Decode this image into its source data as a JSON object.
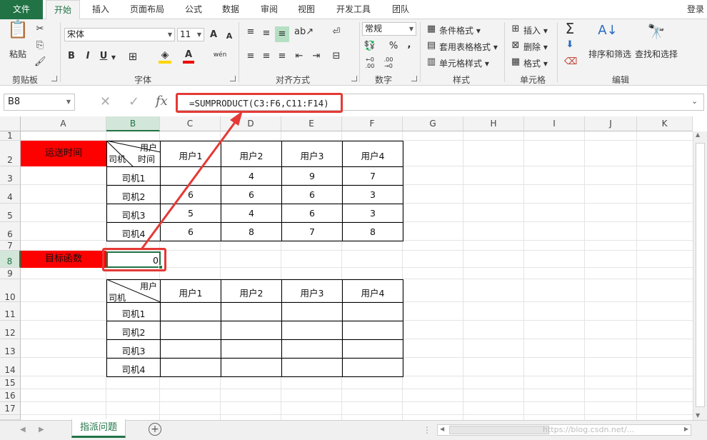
{
  "tabs": [
    "文件",
    "开始",
    "插入",
    "页面布局",
    "公式",
    "数据",
    "审阅",
    "视图",
    "开发工具",
    "团队"
  ],
  "login": "登录",
  "ribbon": {
    "clipboard": {
      "paste": "粘贴",
      "label": "剪贴板"
    },
    "font": {
      "name": "宋体",
      "size": "11",
      "bold": "B",
      "italic": "I",
      "underline": "U",
      "label": "字体",
      "phonetic": "wén"
    },
    "alignment": {
      "label": "对齐方式"
    },
    "number": {
      "format": "常规",
      "percent": "%",
      "comma": ",",
      "label": "数字"
    },
    "styles": {
      "conditional": "条件格式",
      "table_format": "套用表格格式",
      "cell_styles": "单元格样式",
      "label": "样式"
    },
    "cells": {
      "insert": "插入",
      "delete": "删除",
      "format": "格式",
      "label": "单元格"
    },
    "editing": {
      "sort_filter": "排序和筛选",
      "find_select": "查找和选择",
      "label": "编辑"
    }
  },
  "formula_bar": {
    "name_box": "B8",
    "fx": "fx",
    "formula": "=SUMPRODUCT(C3:F6,C11:F14)"
  },
  "columns": [
    "A",
    "B",
    "C",
    "D",
    "E",
    "F",
    "G",
    "H",
    "I",
    "J",
    "K"
  ],
  "rows": [
    "1",
    "2",
    "3",
    "4",
    "5",
    "6",
    "7",
    "8",
    "9",
    "10",
    "11",
    "12",
    "13",
    "14",
    "15",
    "16",
    "17"
  ],
  "sheet": {
    "a2": "运送时间",
    "a8": "目标函数",
    "b8": "0",
    "t1": {
      "corner_top": "用户",
      "corner_mid": "时间",
      "corner_left": "司机",
      "headers": [
        "用户1",
        "用户2",
        "用户3",
        "用户4"
      ],
      "drivers": [
        "司机1",
        "司机2",
        "司机3",
        "司机4"
      ],
      "values": [
        [
          "",
          "4",
          "9",
          "7"
        ],
        [
          "6",
          "6",
          "6",
          "3"
        ],
        [
          "5",
          "4",
          "6",
          "3"
        ],
        [
          "6",
          "8",
          "7",
          "8"
        ]
      ]
    },
    "t2": {
      "corner_top": "用户",
      "corner_left": "司机",
      "headers": [
        "用户1",
        "用户2",
        "用户3",
        "用户4"
      ],
      "drivers": [
        "司机1",
        "司机2",
        "司机3",
        "司机4"
      ]
    }
  },
  "sheet_tab": "指派问题",
  "watermark": "https://blog.csdn.net/..."
}
